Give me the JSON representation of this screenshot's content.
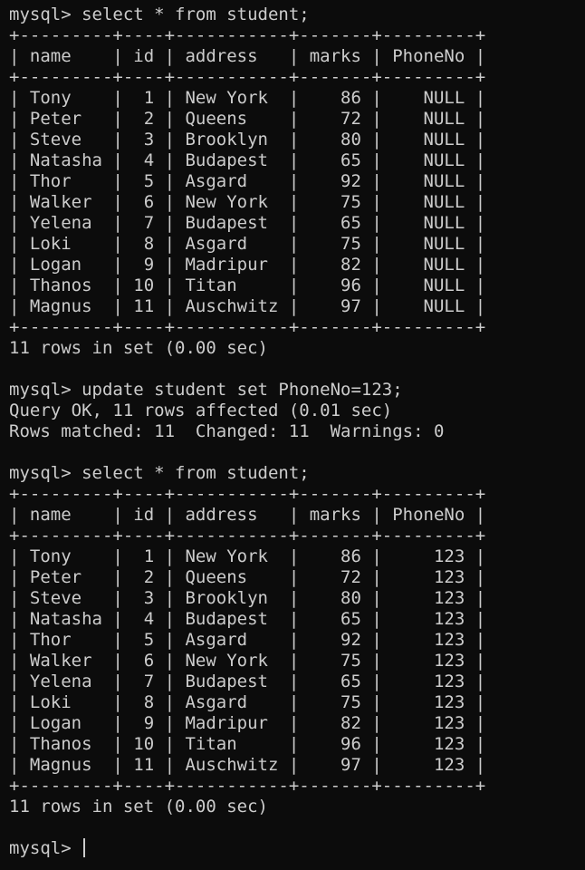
{
  "prompt": "mysql> ",
  "lines": [
    {
      "kind": "command",
      "text": "mysql> select * from student;"
    },
    {
      "kind": "border",
      "text": "+---------+----+-----------+-------+---------+"
    },
    {
      "kind": "header",
      "text": "| name    | id | address   | marks | PhoneNo |"
    },
    {
      "kind": "border",
      "text": "+---------+----+-----------+-------+---------+"
    },
    {
      "kind": "row",
      "text": "| Tony    |  1 | New York  |    86 |    NULL |"
    },
    {
      "kind": "row",
      "text": "| Peter   |  2 | Queens    |    72 |    NULL |"
    },
    {
      "kind": "row",
      "text": "| Steve   |  3 | Brooklyn  |    80 |    NULL |"
    },
    {
      "kind": "row",
      "text": "| Natasha |  4 | Budapest  |    65 |    NULL |"
    },
    {
      "kind": "row",
      "text": "| Thor    |  5 | Asgard    |    92 |    NULL |"
    },
    {
      "kind": "row",
      "text": "| Walker  |  6 | New York  |    75 |    NULL |"
    },
    {
      "kind": "row",
      "text": "| Yelena  |  7 | Budapest  |    65 |    NULL |"
    },
    {
      "kind": "row",
      "text": "| Loki    |  8 | Asgard    |    75 |    NULL |"
    },
    {
      "kind": "row",
      "text": "| Logan   |  9 | Madripur  |    82 |    NULL |"
    },
    {
      "kind": "row",
      "text": "| Thanos  | 10 | Titan     |    96 |    NULL |"
    },
    {
      "kind": "row",
      "text": "| Magnus  | 11 | Auschwitz |    97 |    NULL |"
    },
    {
      "kind": "border",
      "text": "+---------+----+-----------+-------+---------+"
    },
    {
      "kind": "status",
      "text": "11 rows in set (0.00 sec)"
    },
    {
      "kind": "blank",
      "text": ""
    },
    {
      "kind": "command",
      "text": "mysql> update student set PhoneNo=123;"
    },
    {
      "kind": "status",
      "text": "Query OK, 11 rows affected (0.01 sec)"
    },
    {
      "kind": "status",
      "text": "Rows matched: 11  Changed: 11  Warnings: 0"
    },
    {
      "kind": "blank",
      "text": ""
    },
    {
      "kind": "command",
      "text": "mysql> select * from student;"
    },
    {
      "kind": "border",
      "text": "+---------+----+-----------+-------+---------+"
    },
    {
      "kind": "header",
      "text": "| name    | id | address   | marks | PhoneNo |"
    },
    {
      "kind": "border",
      "text": "+---------+----+-----------+-------+---------+"
    },
    {
      "kind": "row",
      "text": "| Tony    |  1 | New York  |    86 |     123 |"
    },
    {
      "kind": "row",
      "text": "| Peter   |  2 | Queens    |    72 |     123 |"
    },
    {
      "kind": "row",
      "text": "| Steve   |  3 | Brooklyn  |    80 |     123 |"
    },
    {
      "kind": "row",
      "text": "| Natasha |  4 | Budapest  |    65 |     123 |"
    },
    {
      "kind": "row",
      "text": "| Thor    |  5 | Asgard    |    92 |     123 |"
    },
    {
      "kind": "row",
      "text": "| Walker  |  6 | New York  |    75 |     123 |"
    },
    {
      "kind": "row",
      "text": "| Yelena  |  7 | Budapest  |    65 |     123 |"
    },
    {
      "kind": "row",
      "text": "| Loki    |  8 | Asgard    |    75 |     123 |"
    },
    {
      "kind": "row",
      "text": "| Logan   |  9 | Madripur  |    82 |     123 |"
    },
    {
      "kind": "row",
      "text": "| Thanos  | 10 | Titan     |    96 |     123 |"
    },
    {
      "kind": "row",
      "text": "| Magnus  | 11 | Auschwitz |    97 |     123 |"
    },
    {
      "kind": "border",
      "text": "+---------+----+-----------+-------+---------+"
    },
    {
      "kind": "status",
      "text": "11 rows in set (0.00 sec)"
    },
    {
      "kind": "blank",
      "text": ""
    }
  ],
  "colors": {
    "background": "#0c0c0c",
    "foreground": "#cccccc"
  }
}
